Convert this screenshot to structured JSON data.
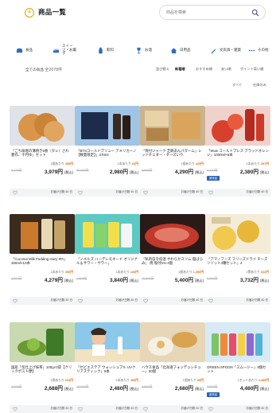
{
  "header": {
    "title": "商品一覧",
    "logo_glyph": "¥",
    "search_placeholder": "商品を検索"
  },
  "categories": [
    {
      "label": "食品",
      "icon": "bread-icon"
    },
    {
      "label": "スイーツ・お菓子",
      "icon": "cake-icon"
    },
    {
      "label": "飲料",
      "icon": "bottle-icon"
    },
    {
      "label": "お酒",
      "icon": "wine-icon"
    },
    {
      "label": "日用品",
      "icon": "home-goods-icon"
    },
    {
      "label": "文房具・雑貨",
      "icon": "pen-icon"
    },
    {
      "label": "その他",
      "icon": "more-icon"
    }
  ],
  "listing": {
    "count_label": "全ての商品",
    "count_value": "全2078件",
    "sort_label": "並び替え",
    "sort_options": [
      "新着順",
      "おすすめ順",
      "安い順",
      "ポイント高い順"
    ],
    "pager": [
      "すべて",
      "在庫のみ"
    ]
  },
  "products": [
    {
      "name": "「ごち味噌の薄焼き5枚（タレ）さわ 豊作、千円ゆ」セット",
      "unit": "1個あたり",
      "points": "459円",
      "ref": "3,776円",
      "price": "3,979円",
      "tax": "(税込)",
      "badge": "",
      "delivery": "お届け日数 40 日"
    },
    {
      "name": "「BTSコールドブリュー アメリカーノ【数量限定】」370ml",
      "unit": "1本あたり",
      "points": "62円",
      "ref": "20,000円",
      "price": "2,980円",
      "tax": "(税込)",
      "badge": "",
      "delivery": "お届け日数 40 日"
    },
    {
      "name": "「骨付ジャーク 芝麻あんパターム」レッドチェダー・チーズいり",
      "unit": "1個あたり",
      "points": "429円",
      "ref": "5,800円",
      "price": "4,290円",
      "tax": "(税込)",
      "badge": "",
      "delivery": "お届け日数 40 日"
    },
    {
      "name": "「Wow コールドプレス ブラッドオレンジ」1000ml×6本",
      "unit": "1本あたり",
      "points": "397円",
      "ref": "4,770円",
      "price": "2,380円",
      "tax": "(税込)",
      "badge": "新商品",
      "delivery": "お届け日数 40 日"
    },
    {
      "name": "「Coconut Milk Pudding Hazy IPA」350ml×12本",
      "unit": "1本あたり",
      "points": "356円",
      "ref": "4,800円",
      "price": "4,279円",
      "tax": "(税込)",
      "badge": "",
      "delivery": "お届け日数 40 日"
    },
    {
      "name": "「ノメルズ ハーデレモネード オリジナル＆サワー・サワー」",
      "unit": "1本あたり",
      "points": "160円",
      "ref": "4,800円",
      "price": "3,840円",
      "tax": "(税込)",
      "badge": "",
      "delivery": "お届け日数 40 日"
    },
    {
      "name": "「私的缶を低温 やわらかスリム 脂ばらみ」 焼 塩付5%‐4個",
      "unit": "1個あたり",
      "points": "1,350円",
      "ref": "10,800円",
      "price": "5,400円",
      "tax": "(税込)",
      "badge": "",
      "delivery": "お届け日数 40 日"
    },
    {
      "name": "「アマノフーズ フリーズドライ チーズリゾット3種セット」4",
      "unit": "1食あたり",
      "points": "622円",
      "ref": "5,800円",
      "price": "3,732円",
      "tax": "(税込)",
      "badge": "",
      "delivery": "お届け日数 40 日"
    },
    {
      "name": "国産「伝仕上げ抹茶」100g×2袋【クリックポスト便】",
      "unit": "1袋あたり",
      "points": "634円",
      "ref": "4,800円",
      "price": "2,688円",
      "tax": "(税込)",
      "badge": "",
      "delivery": "お届け日数 40 日"
    },
    {
      "name": "「セビエステア ウォッシュブル UVクリアスティック」5本",
      "unit": "1本あたり",
      "points": "496円",
      "ref": "10,000円",
      "price": "2,480円",
      "tax": "(税込)",
      "badge": "",
      "delivery": "お届け日数 40 日"
    },
    {
      "name": "ハウス食品「北海道フォンデュシチュー」30個",
      "unit": "1個あたり",
      "points": "89円",
      "ref": "8,800円",
      "price": "2,680円",
      "tax": "(税込)",
      "badge": "",
      "delivery": "お届け日数 40 日"
    },
    {
      "name": "GREEN SPOON「スムージー」8個セット",
      "unit": "1セットあたり",
      "points": "4,480円",
      "ref": "7,800円",
      "price": "4,480円",
      "tax": "(税込)",
      "badge": "新商品",
      "delivery": "お届け日数 40 日"
    }
  ],
  "colors": {
    "accent": "#e0a300",
    "points": "#e06f1a",
    "badge": "#2862b8"
  }
}
